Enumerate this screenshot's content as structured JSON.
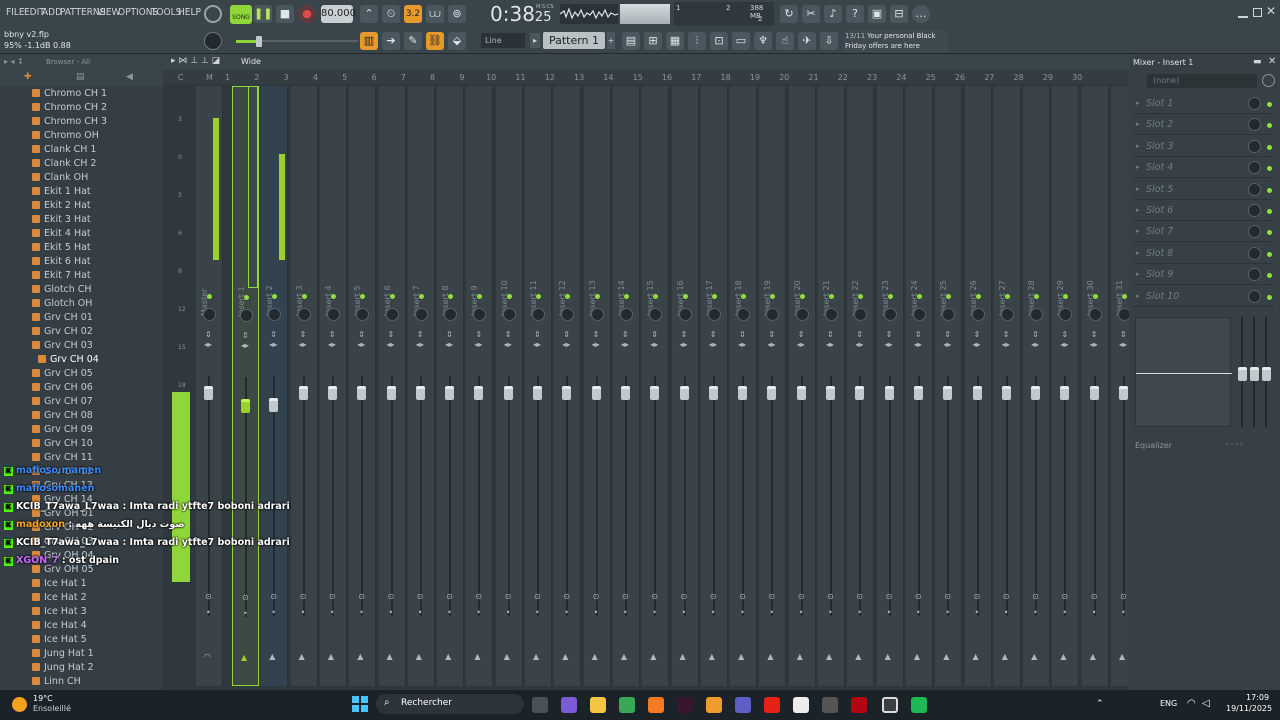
{
  "menu": [
    "FILE",
    "EDIT",
    "ADD",
    "PATTERNS",
    "VIEW",
    "OPTIONS",
    "TOOLS",
    "HELP"
  ],
  "transport": {
    "song_label": "SONG",
    "tempo": "80.000",
    "time": "0:38",
    "time_sub": "25",
    "time_unit": "M:S:CS"
  },
  "cpu": {
    "ram": "388 MB",
    "voices": "2",
    "cpu_value": "1"
  },
  "project": {
    "file": "bbny v2.flp",
    "status": "95%  -1.1dB  0.88"
  },
  "pattern": {
    "snap": "Line",
    "name": "Pattern 1"
  },
  "news": {
    "count": "13/11",
    "text_line1": "Your personal Black",
    "text_line2": "Friday offers are here"
  },
  "browser": {
    "label": "Browser - All",
    "files": [
      "Chromo CH 1",
      "Chromo CH 2",
      "Chromo CH 3",
      "Chromo OH",
      "Clank CH 1",
      "Clank CH 2",
      "Clank OH",
      "Ekit 1 Hat",
      "Ekit 2 Hat",
      "Ekit 3 Hat",
      "Ekit 4 Hat",
      "Ekit 5 Hat",
      "Ekit 6 Hat",
      "Ekit 7 Hat",
      "Glotch CH",
      "Glotch OH",
      "Grv CH 01",
      "Grv CH 02",
      "Grv CH 03",
      "Grv CH 04",
      "Grv CH 05",
      "Grv CH 06",
      "Grv CH 07",
      "Grv CH 08",
      "Grv CH 09",
      "Grv CH 10",
      "Grv CH 11",
      "Grv CH 12",
      "Grv CH 13",
      "Grv CH 14",
      "Grv OH 01",
      "Grv OH 02",
      "Grv OH 03",
      "Grv OH 04",
      "Grv OH 05",
      "Ice Hat 1",
      "Ice Hat 2",
      "Ice Hat 3",
      "Ice Hat 4",
      "Ice Hat 5",
      "Jung Hat 1",
      "Jung Hat 2",
      "Linn CH"
    ],
    "selected_index": 19
  },
  "mixer": {
    "view": "Wide",
    "columns": [
      "C",
      "M",
      "1",
      "2",
      "3",
      "4",
      "5",
      "6",
      "7",
      "8",
      "9",
      "10",
      "11",
      "12",
      "13",
      "14",
      "15",
      "16",
      "17",
      "18",
      "19",
      "20",
      "21",
      "22",
      "23",
      "24",
      "25",
      "26",
      "27",
      "28",
      "29",
      "30"
    ],
    "strips": [
      "Master",
      "Insert 1",
      "Insert 2",
      "Insert 3",
      "Insert 4",
      "Insert 5",
      "Insert 6",
      "Insert 7",
      "Insert 8",
      "Insert 9",
      "Insert 10",
      "Insert 11",
      "Insert 12",
      "Insert 13",
      "Insert 14",
      "Insert 15",
      "Insert 16",
      "Insert 17",
      "Insert 18",
      "Insert 19",
      "Insert 20",
      "Insert 21",
      "Insert 22",
      "Insert 23",
      "Insert 24",
      "Insert 25",
      "Insert 26",
      "Insert 27",
      "Insert 28",
      "Insert 29",
      "Insert 30",
      "Insert 31"
    ],
    "scale": [
      "3",
      "0",
      "3",
      "6",
      "9",
      "12",
      "15",
      "18"
    ]
  },
  "insert_panel": {
    "title": "Mixer - Insert 1",
    "preset": "(none)",
    "slots": [
      "Slot 1",
      "Slot 2",
      "Slot 3",
      "Slot 4",
      "Slot 5",
      "Slot 6",
      "Slot 7",
      "Slot 8",
      "Slot 9",
      "Slot 10"
    ],
    "eq_label": "Equalizer"
  },
  "chat": [
    {
      "user": "mafioso.mamen",
      "msg": "",
      "color": "#3b8cff"
    },
    {
      "user": "mafiosomanen",
      "msg": "",
      "color": "#3b8cff"
    },
    {
      "user": "KCIB_T7awa_L7waa",
      "msg": " : Imta radi ytfte7 boboni adrari",
      "color": "#ffffff"
    },
    {
      "user": "madoxon",
      "msg": " : صوت ديال الكنيسة ههه",
      "color": "#f5a623"
    },
    {
      "user": "KCIB_T7awa_L7waa",
      "msg": " : Imta radi ytfte7 boboni adrari",
      "color": "#ffffff"
    },
    {
      "user": "XGON_7",
      "msg": " : ost dpain",
      "color": "#c56cff"
    }
  ],
  "taskbar": {
    "weather_temp": "19°C",
    "weather_desc": "Ensoleillé",
    "search": "Rechercher",
    "lang": "ENG",
    "time": "17:09",
    "date": "19/11/2025"
  },
  "colors": {
    "accent": "#e59a2b",
    "meter": "#9ad12f",
    "led": "#8fe03c"
  }
}
